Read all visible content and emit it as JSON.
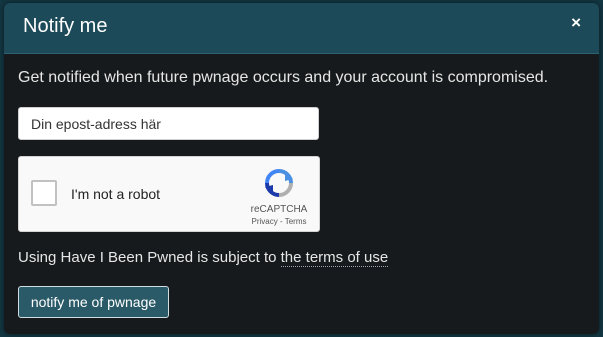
{
  "modal": {
    "title": "Notify me",
    "close_label": "×",
    "intro": "Get notified when future pwnage occurs and your account is compromised.",
    "email_value": "Din epost-adress här",
    "captcha": {
      "label": "I'm not a robot",
      "brand": "reCAPTCHA",
      "privacy": "Privacy",
      "separator": " - ",
      "terms": "Terms",
      "checked": false
    },
    "terms_prefix": "Using Have I Been Pwned is subject to ",
    "terms_link": "the terms of use",
    "submit_label": "notify me of pwnage"
  },
  "colors": {
    "header_bg": "#1d4a58",
    "body_bg": "#161a1c",
    "button_bg": "#2a5968"
  }
}
